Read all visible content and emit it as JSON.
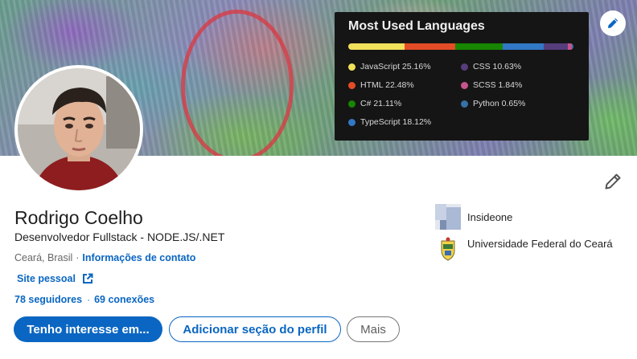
{
  "banner": {
    "language_card": {
      "title": "Most Used Languages",
      "languages": [
        {
          "label": "JavaScript 25.16%",
          "name": "JavaScript",
          "percent": 25.16,
          "color": "#f1e05a"
        },
        {
          "label": "HTML 22.48%",
          "name": "HTML",
          "percent": 22.48,
          "color": "#e34c26"
        },
        {
          "label": "C# 21.11%",
          "name": "C#",
          "percent": 21.11,
          "color": "#178600"
        },
        {
          "label": "TypeScript 18.12%",
          "name": "TypeScript",
          "percent": 18.12,
          "color": "#3178c6"
        },
        {
          "label": "CSS 10.63%",
          "name": "CSS",
          "percent": 10.63,
          "color": "#563d7c"
        },
        {
          "label": "SCSS 1.84%",
          "name": "SCSS",
          "percent": 1.84,
          "color": "#c6538c"
        },
        {
          "label": "Python 0.65%",
          "name": "Python",
          "percent": 0.65,
          "color": "#3572a5"
        }
      ]
    },
    "edit_icon": "pencil-icon"
  },
  "profile": {
    "name": "Rodrigo Coelho",
    "headline": "Desenvolvedor Fullstack - NODE.JS/.NET",
    "location": "Ceará, Brasil",
    "location_separator": "·",
    "contact_info_link": "Informações de contato",
    "website_link": "Site pessoal",
    "followers": "78 seguidores",
    "connections_separator": "·",
    "connections": "69 conexões",
    "edit_icon": "pencil-icon"
  },
  "actions": {
    "primary": "Tenho interesse em...",
    "add_section": "Adicionar seção do perfil",
    "more": "Mais"
  },
  "organizations": [
    {
      "name": "Insideone"
    },
    {
      "name": "Universidade Federal do Ceará"
    }
  ],
  "colors": {
    "accent": "#0a66c2",
    "card_background": "#151515"
  }
}
